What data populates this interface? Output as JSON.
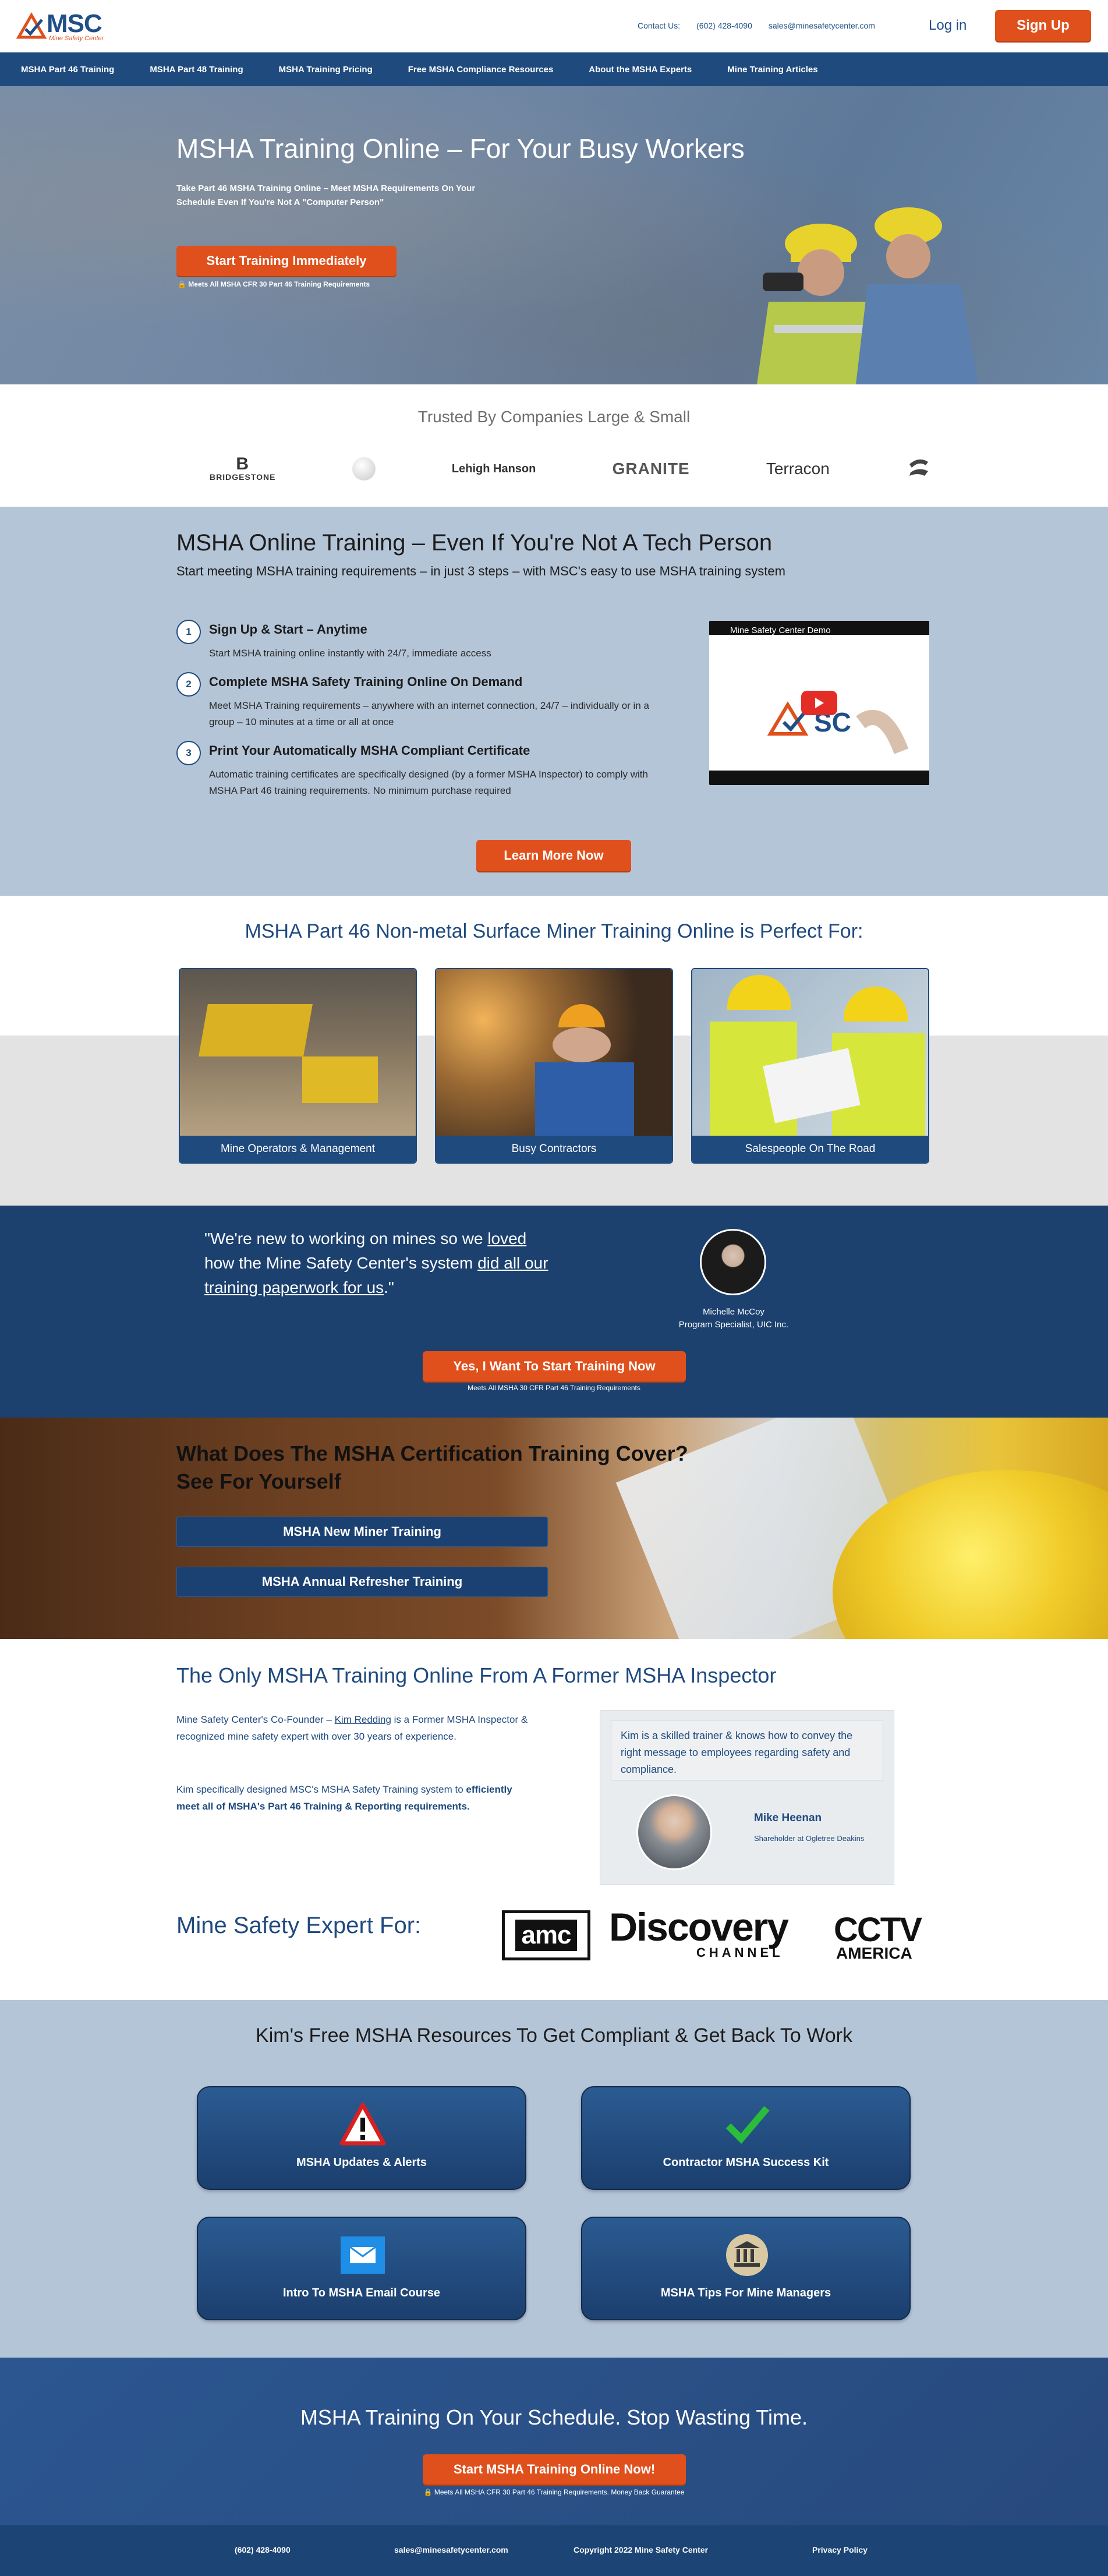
{
  "header": {
    "logo_text": "MSC",
    "logo_sub": "Mine Safety Center",
    "contact_label": "Contact Us:",
    "phone": "(602) 428-4090",
    "email": "sales@minesafetycenter.com",
    "login": "Log in",
    "signup": "Sign Up"
  },
  "nav": [
    "MSHA Part 46 Training",
    "MSHA Part 48 Training",
    "MSHA Training Pricing",
    "Free MSHA Compliance Resources",
    "About the MSHA Experts",
    "Mine Training Articles"
  ],
  "hero": {
    "title": "MSHA Training Online – For Your Busy Workers",
    "subtitle": "Take Part 46 MSHA Training Online – Meet MSHA Requirements On Your Schedule Even If You're Not A \"Computer Person\"",
    "cta": "Start Training Immediately",
    "meets": "Meets All MSHA CFR 30 Part 46 Training Requirements"
  },
  "trusted": {
    "title": "Trusted By Companies Large & Small",
    "brands": [
      "BRIDGESTONE",
      "",
      "Lehigh Hanson",
      "GRANITE",
      "Terracon",
      ""
    ]
  },
  "online": {
    "title": "MSHA Online Training – Even If You're Not A Tech Person",
    "lead": "Start meeting MSHA training requirements – in just 3 steps – with MSC's easy to use MSHA training system",
    "steps": [
      {
        "num": "1",
        "title": "Sign Up & Start – Anytime",
        "desc": "Start MSHA training online instantly with 24/7, immediate access"
      },
      {
        "num": "2",
        "title": "Complete MSHA Safety Training Online On Demand",
        "desc": "Meet MSHA Training requirements – anywhere with an internet connection, 24/7 – individually or in a group – 10 minutes at a time or all at once"
      },
      {
        "num": "3",
        "title": "Print Your Automatically MSHA Compliant Certificate",
        "desc": "Automatic training certificates are specifically designed (by a former MSHA Inspector) to comply with MSHA Part 46 training requirements. No minimum purchase required"
      }
    ],
    "video_title": "Mine Safety Center Demo",
    "learn_more": "Learn More Now"
  },
  "perfect": {
    "title": "MSHA Part 46 Non-metal Surface Miner Training Online is Perfect For:",
    "cards": [
      "Mine Operators & Management",
      "Busy Contractors",
      "Salespeople On The Road"
    ]
  },
  "testimonial": {
    "q1": "\"We're new to working on mines so we ",
    "q_loved": "loved",
    "q2": " how the Mine Safety Center's system ",
    "q_did": "did all our training paperwork for us",
    "q3": ".\"",
    "name": "Michelle McCoy",
    "role": "Program Specialist, UIC Inc.",
    "cta": "Yes, I Want To Start Training Now",
    "meets": "Meets All MSHA 30 CFR Part 46 Training Requirements"
  },
  "cover": {
    "title_line1": "What Does The MSHA Certification Training Cover?",
    "title_line2": "See For Yourself",
    "btn_new": "MSHA New Miner Training",
    "btn_annual": "MSHA Annual Refresher Training"
  },
  "inspector": {
    "title": "The Only MSHA Training Online From A Former MSHA Inspector",
    "p1_a": "Mine Safety Center's Co-Founder – ",
    "p1_link": "Kim Redding",
    "p1_b": " is a Former MSHA Inspector & recognized mine safety expert with over 30 years of experience.",
    "p2_a": "Kim specifically designed MSC's MSHA Safety Training system to ",
    "p2_b": "efficiently meet all of MSHA's Part 46 Training & Reporting requirements.",
    "quote": "Kim is a skilled trainer & knows how to convey the right message to employees regarding safety and compliance.",
    "quote_name": "Mike Heenan",
    "quote_title": "Shareholder at Ogletree Deakins",
    "expert_for": "Mine Safety Expert For:",
    "amc": "amc",
    "discovery": "Discovery",
    "channel": "CHANNEL",
    "cctv": "CCTV",
    "america": "AMERICA"
  },
  "resources": {
    "title": "Kim's Free MSHA Resources To Get Compliant & Get Back To Work",
    "cards": [
      {
        "label": "MSHA Updates & Alerts",
        "icon": "warning-icon"
      },
      {
        "label": "Contractor MSHA Success Kit",
        "icon": "checkmark-icon"
      },
      {
        "label": "Intro To MSHA Email Course",
        "icon": "envelope-icon"
      },
      {
        "label": "MSHA Tips For Mine Managers",
        "icon": "bank-icon"
      }
    ]
  },
  "footer_cta": {
    "title": "MSHA Training On Your Schedule. Stop Wasting Time.",
    "cta": "Start MSHA Training Online Now!",
    "meets": "Meets All MSHA CFR 30 Part 46 Training Requirements. Money Back Guarantee"
  },
  "footer": {
    "phone": "(602) 428-4090",
    "email": "sales@minesafetycenter.com",
    "copyright": "Copyright 2022 Mine Safety Center",
    "privacy": "Privacy Policy"
  },
  "colors": {
    "accent": "#e0501c",
    "navy": "#1f4a7e",
    "slate": "#b5c5d8"
  }
}
